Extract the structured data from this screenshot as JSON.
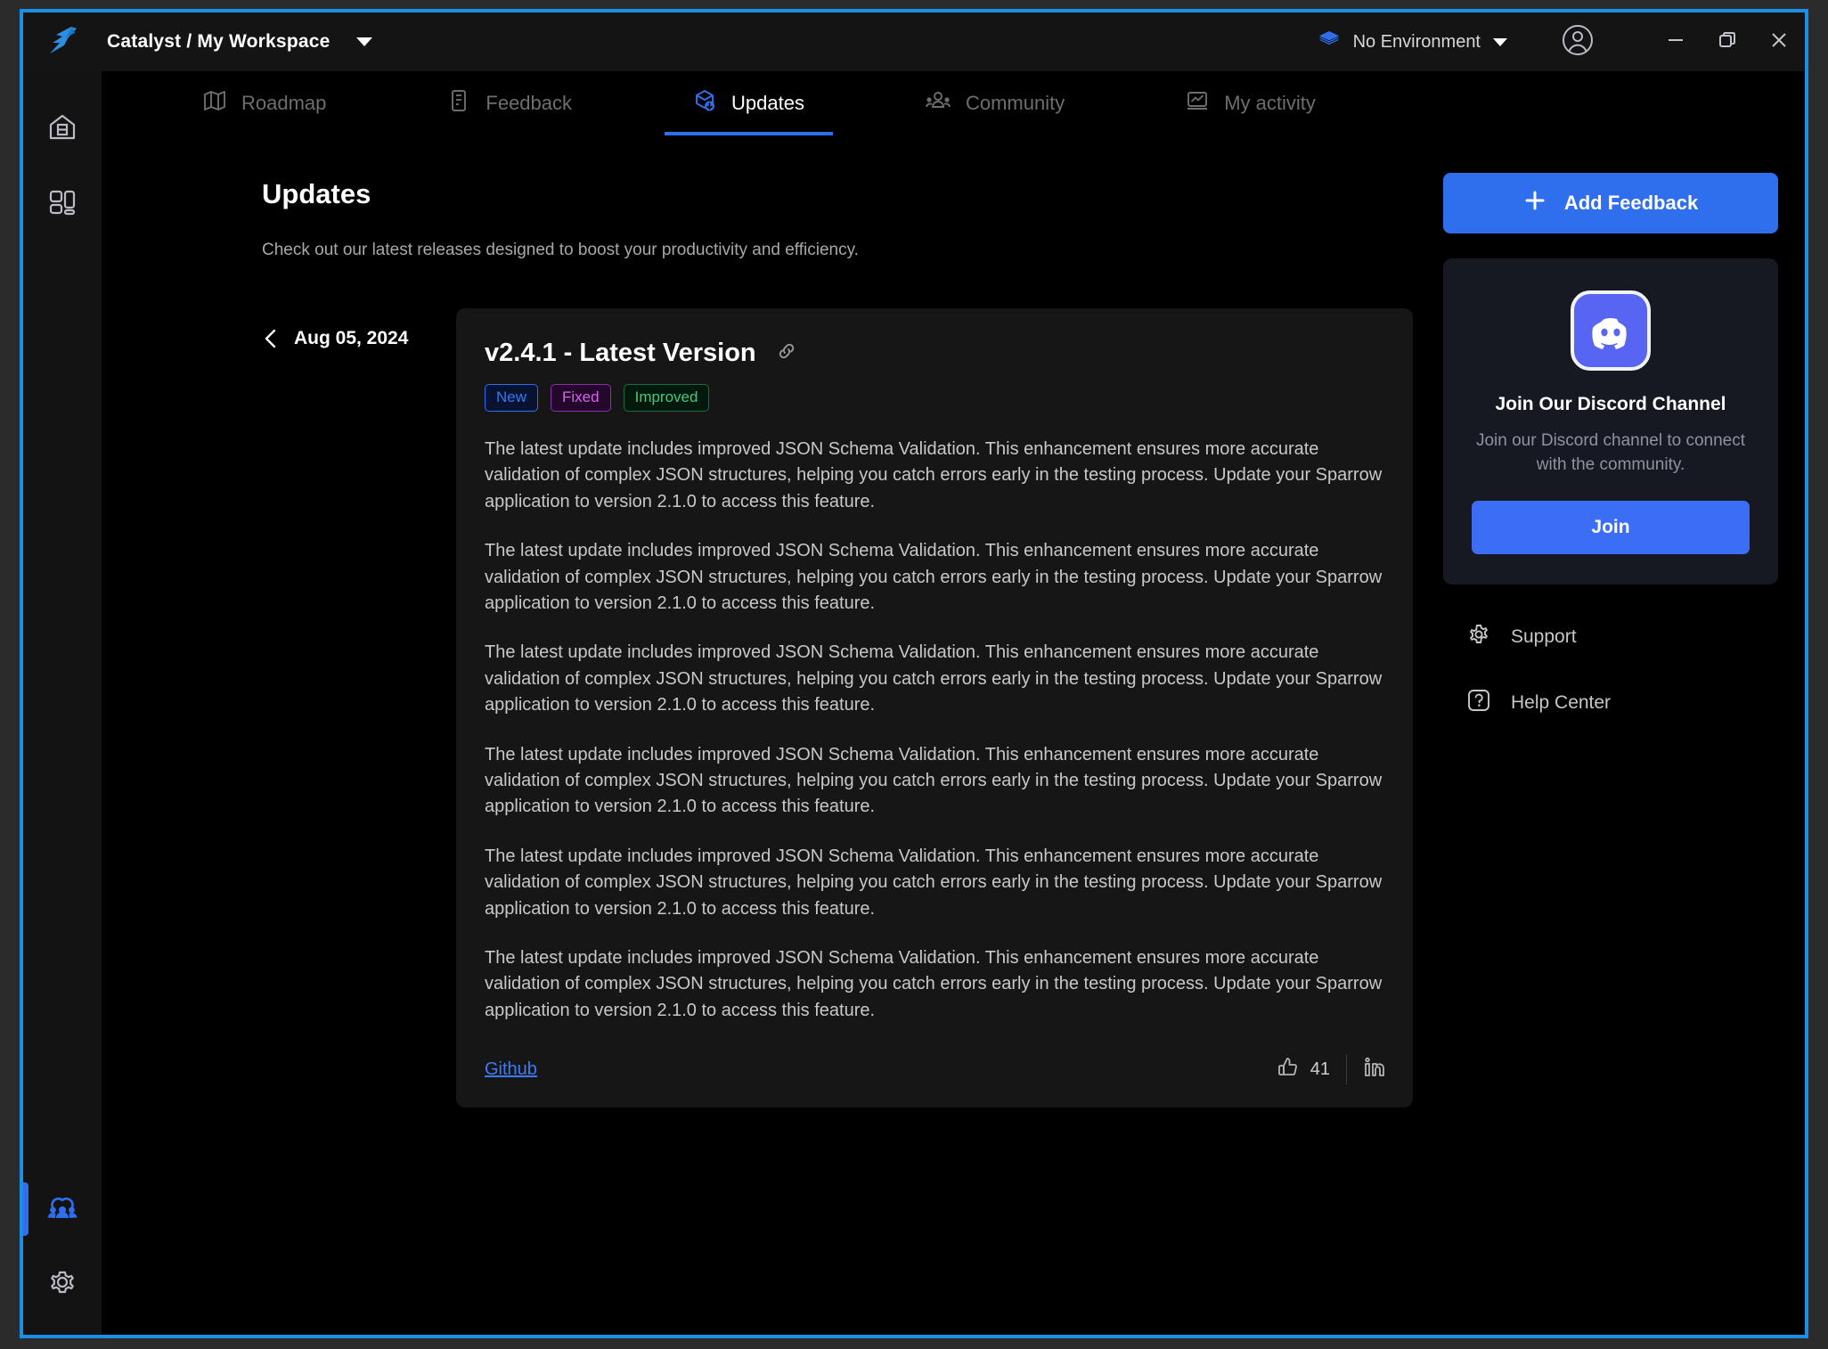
{
  "titlebar": {
    "logo_icon": "sparrow-bird-logo",
    "workspace": "Catalyst / My Workspace",
    "workspace_caret_icon": "chevron-down-icon",
    "environment": {
      "icon": "layers-icon",
      "label": "No Environment",
      "caret_icon": "chevron-down-icon"
    },
    "account_icon": "user-account-icon",
    "window_controls": {
      "minimize_icon": "minimize-icon",
      "maximize_icon": "restore-window-icon",
      "close_icon": "close-icon"
    }
  },
  "rail": {
    "top_items": [
      {
        "icon": "home-workspace-icon",
        "active": false
      },
      {
        "icon": "collections-grid-icon",
        "active": false
      }
    ],
    "bottom_items": [
      {
        "icon": "community-people-icon",
        "active": true
      },
      {
        "icon": "settings-gear-icon",
        "active": false
      }
    ]
  },
  "tabs": [
    {
      "label": "Roadmap",
      "icon": "map-icon",
      "active": false
    },
    {
      "label": "Feedback",
      "icon": "document-icon",
      "active": false
    },
    {
      "label": "Updates",
      "icon": "package-download-icon",
      "active": true
    },
    {
      "label": "Community",
      "icon": "people-icon",
      "active": false
    },
    {
      "label": "My activity",
      "icon": "activity-chart-icon",
      "active": false
    }
  ],
  "page": {
    "title": "Updates",
    "subtitle": "Check out our latest releases designed to boost your productivity and efficiency."
  },
  "release": {
    "back_icon": "chevron-left-icon",
    "date": "Aug 05, 2024",
    "version_title": "v2.4.1 - Latest Version",
    "link_icon": "chain-link-icon",
    "badges": [
      {
        "label": "New",
        "style": "new"
      },
      {
        "label": "Fixed",
        "style": "fixed"
      },
      {
        "label": "Improved",
        "style": "improved"
      }
    ],
    "paragraphs": [
      "The latest update includes improved JSON Schema Validation. This enhancement ensures more accurate validation of complex JSON structures, helping you catch errors early in the testing process. Update your Sparrow application to version 2.1.0 to access this feature.",
      "The latest update includes improved JSON Schema Validation. This enhancement ensures more accurate validation of complex JSON structures, helping you catch errors early in the testing process. Update your Sparrow application to version 2.1.0 to access this feature.",
      "The latest update includes improved JSON Schema Validation. This enhancement ensures more accurate validation of complex JSON structures, helping you catch errors early in the testing process. Update your Sparrow application to version 2.1.0 to access this feature.",
      "The latest update includes improved JSON Schema Validation. This enhancement ensures more accurate validation of complex JSON structures, helping you catch errors early in the testing process. Update your Sparrow application to version 2.1.0 to access this feature.",
      "The latest update includes improved JSON Schema Validation. This enhancement ensures more accurate validation of complex JSON structures, helping you catch errors early in the testing process. Update your Sparrow application to version 2.1.0 to access this feature.",
      "The latest update includes improved JSON Schema Validation. This enhancement ensures more accurate validation of complex JSON structures, helping you catch errors early in the testing process. Update your Sparrow application to version 2.1.0 to access this feature."
    ],
    "footer": {
      "link_label": "Github",
      "like_icon": "thumbs-up-icon",
      "like_count": "41",
      "share_icon": "linkedin-icon"
    }
  },
  "sidebar": {
    "add_feedback": {
      "label": "Add Feedback",
      "icon": "plus-icon"
    },
    "discord": {
      "logo_icon": "discord-logo-icon",
      "title": "Join Our Discord Channel",
      "description": "Join our Discord channel to connect with the community.",
      "button_label": "Join"
    },
    "links": [
      {
        "label": "Support",
        "icon": "settings-gear-icon"
      },
      {
        "label": "Help Center",
        "icon": "question-help-icon"
      }
    ]
  },
  "colors": {
    "accent_blue": "#2f6fed",
    "window_border": "#1a8fe3",
    "discord_blurple": "#5865f2",
    "badge_new": "#2f7bf5",
    "badge_fixed": "#d963f0",
    "badge_improved": "#44c97a",
    "link_blue": "#3d7bf7"
  }
}
